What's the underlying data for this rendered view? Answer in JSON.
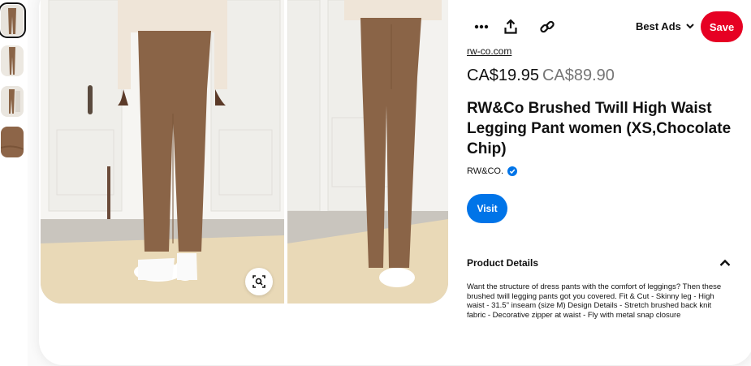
{
  "thumbnails": [
    {
      "name": "thumb-1",
      "active": true
    },
    {
      "name": "thumb-2",
      "active": false
    },
    {
      "name": "thumb-3",
      "active": false
    },
    {
      "name": "thumb-4",
      "active": false
    }
  ],
  "toolbar": {
    "more_icon": "more-dots-icon",
    "share_icon": "share-upload-icon",
    "link_icon": "link-icon",
    "board_label": "Best Ads",
    "board_icon": "chevron-down-icon",
    "save_label": "Save"
  },
  "product": {
    "domain": "rw-co.com",
    "price_current": "CA$19.95",
    "price_original": "CA$89.90",
    "title": "RW&Co Brushed Twill High Waist Legging Pant women (XS,Chocolate Chip)",
    "brand": "RW&CO.",
    "visit_label": "Visit"
  },
  "details": {
    "heading": "Product Details",
    "text": "Want the structure of dress pants with the comfort of leggings? Then these brushed twill legging pants got you covered. Fit & Cut - Skinny leg - High waist - 31.5\" inseam (size M) Design Details - Stretch brushed back knit fabric - Decorative zipper at waist - Fly with metal snap closure"
  },
  "colors": {
    "save": "#e60023",
    "visit": "#0074e8",
    "pant": "#8a6447"
  }
}
